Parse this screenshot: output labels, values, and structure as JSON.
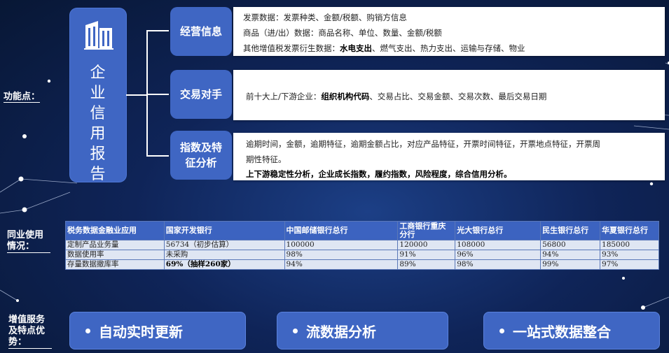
{
  "side_labels": {
    "features": "功能点：",
    "peer_usage": "同业使用情况：",
    "value_added": "增值服务及特点优势："
  },
  "company_card": {
    "icon": "building-icon",
    "title": "企业信用报告"
  },
  "categories": [
    {
      "label": "经营信息",
      "lines": [
        [
          {
            "t": "发票数据：发票种类、金额/税额、购销方信息",
            "b": false
          }
        ],
        [
          {
            "t": "商品（进/出）数据：商品名称、单位、数量、金额/税额",
            "b": false
          }
        ],
        [
          {
            "t": "其他增值税发票衍生数据：",
            "b": false
          },
          {
            "t": "水电支出",
            "b": true
          },
          {
            "t": "、燃气支出、热力支出、运输与存储、物业",
            "b": false
          }
        ]
      ]
    },
    {
      "label": "交易对手",
      "lines": [
        [
          {
            "t": "前十大上/下游企业：",
            "b": false
          },
          {
            "t": "组织机构代码",
            "b": true
          },
          {
            "t": "、交易占比、交易金额、交易次数、最后交易日期",
            "b": false
          }
        ]
      ]
    },
    {
      "label": "指数及特征分析",
      "lines": [
        [
          {
            "t": "逾期时间，金额，逾期特征，逾期金额占比，对应产品特征，开票时间特征，开票地点特征，开票周",
            "b": false
          }
        ],
        [
          {
            "t": "期性特征。",
            "b": false
          }
        ],
        [
          {
            "t": "上下游稳定性分析，企业成长指数，履约指数，风险程度，综合信用分析。",
            "b": true
          }
        ]
      ]
    }
  ],
  "table": {
    "headers": [
      "税务数据金融业应用",
      "国家开发银行",
      "中国邮储银行总行",
      "工商银行重庆分行",
      "光大银行总行",
      "民生银行总行",
      "华夏银行总行"
    ],
    "rows": [
      [
        "定制产品业务量",
        "56734（初步估算）",
        "100000",
        "120000",
        "108000",
        "56800",
        "185000"
      ],
      [
        "数据使用率",
        "未采购",
        "98%",
        "91%",
        "96%",
        "94%",
        "93%"
      ],
      [
        "存量数据撤库率",
        "69%（抽样260家）",
        "94%",
        "89%",
        "98%",
        "99%",
        "97%"
      ]
    ]
  },
  "advantages": [
    "自动实时更新",
    "流数据分析",
    "一站式数据整合"
  ]
}
